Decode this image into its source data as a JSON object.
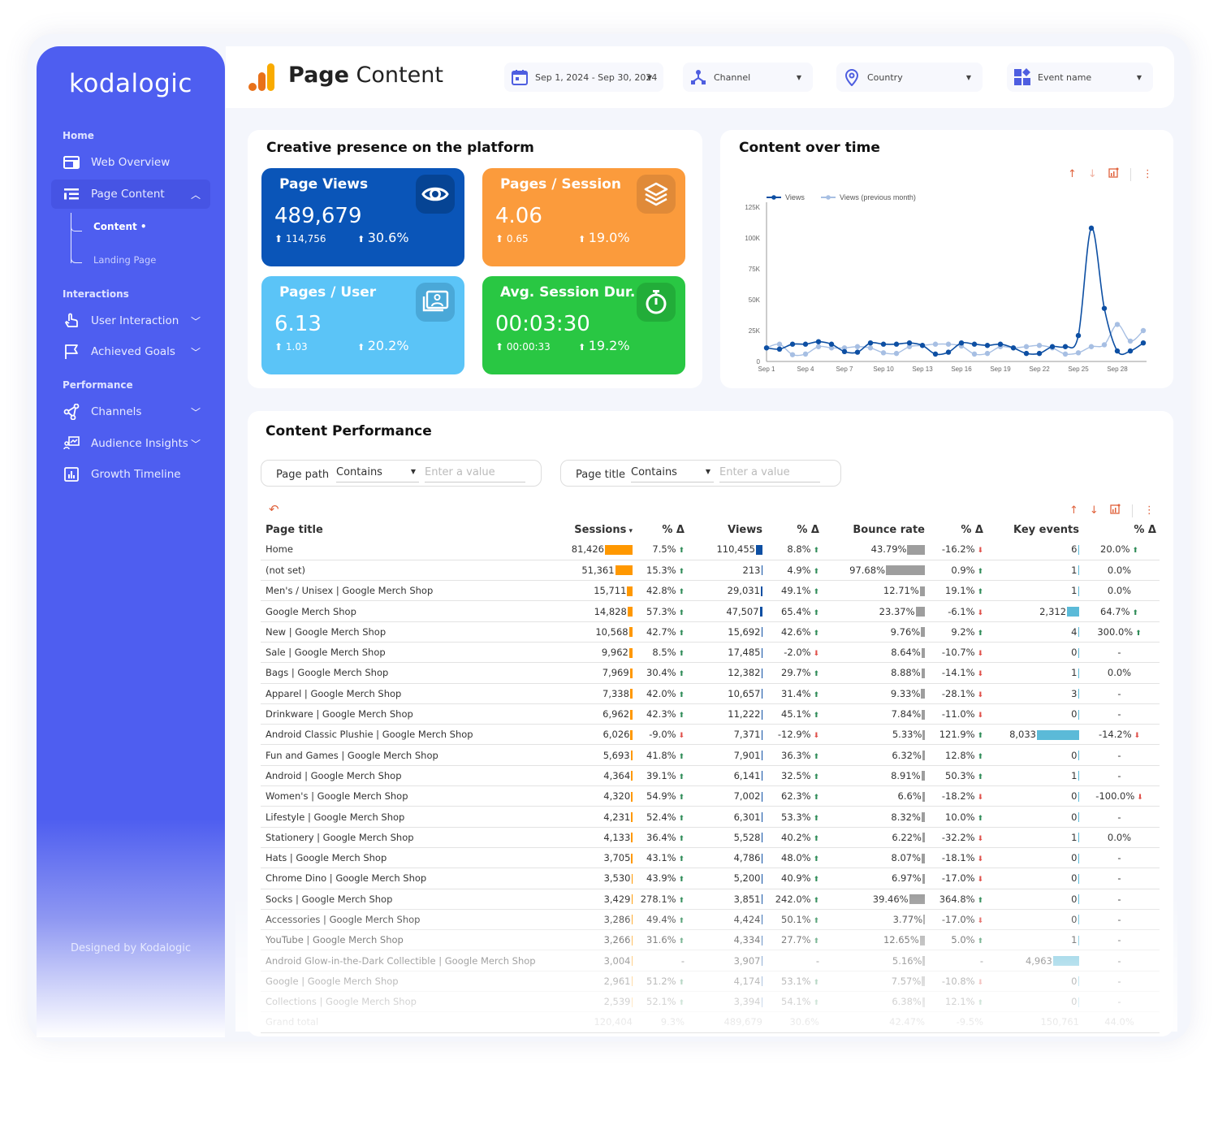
{
  "sidebar": {
    "logo": "kodalogic",
    "sections": [
      {
        "label": "Home"
      },
      {
        "label": "Interactions"
      },
      {
        "label": "Performance"
      }
    ],
    "items": [
      {
        "label": "Web Overview",
        "icon": "layout-icon"
      },
      {
        "label": "Page Content",
        "icon": "list-icon",
        "expanded": true
      },
      {
        "label": "User Interaction",
        "icon": "hand-pointer-icon"
      },
      {
        "label": "Achieved Goals",
        "icon": "flag-icon"
      },
      {
        "label": "Channels",
        "icon": "share-nodes-icon"
      },
      {
        "label": "Audience Insights",
        "icon": "presentation-icon"
      },
      {
        "label": "Growth Timeline",
        "icon": "bar-chart-icon"
      }
    ],
    "subitems": [
      {
        "label": "Content •",
        "active": true
      },
      {
        "label": "Landing Page",
        "active": false
      }
    ],
    "footer": "Designed by Kodalogic"
  },
  "header": {
    "title_bold": "Page",
    "title_rest": " Content",
    "filters": [
      {
        "label": "Sep 1, 2024 - Sep 30, 2024",
        "icon": "calendar-icon"
      },
      {
        "label": "Channel",
        "icon": "hierarchy-icon"
      },
      {
        "label": "Country",
        "icon": "location-pin-icon"
      },
      {
        "label": "Event name",
        "icon": "widgets-icon"
      }
    ]
  },
  "kpi_card": {
    "title": "Creative presence on the platform",
    "kpis": [
      {
        "title": "Page Views",
        "value": "489,679",
        "change_abs": "114,756",
        "change_pct": "30.6%",
        "color": "#0a55b8",
        "icon": "eye-icon"
      },
      {
        "title": "Pages / Session",
        "value": "4.06",
        "change_abs": "0.65",
        "change_pct": "19.0%",
        "color": "#fb9b3c",
        "icon": "layers-icon"
      },
      {
        "title": "Pages / User",
        "value": "6.13",
        "change_abs": "1.03",
        "change_pct": "20.2%",
        "color": "#5bc4f7",
        "icon": "user-portrait-icon"
      },
      {
        "title": "Avg. Session Dur.",
        "value": "00:03:30",
        "change_abs": "00:00:33",
        "change_pct": "19.2%",
        "color": "#29c743",
        "icon": "stopwatch-icon"
      }
    ]
  },
  "chart_data": {
    "type": "line",
    "title": "Content over time",
    "x": [
      "Sep 1",
      "Sep 2",
      "Sep 3",
      "Sep 4",
      "Sep 5",
      "Sep 6",
      "Sep 7",
      "Sep 8",
      "Sep 9",
      "Sep 10",
      "Sep 11",
      "Sep 12",
      "Sep 13",
      "Sep 14",
      "Sep 15",
      "Sep 16",
      "Sep 17",
      "Sep 18",
      "Sep 19",
      "Sep 20",
      "Sep 21",
      "Sep 22",
      "Sep 23",
      "Sep 24",
      "Sep 25",
      "Sep 26",
      "Sep 27",
      "Sep 28",
      "Sep 29",
      "Sep 30"
    ],
    "x_tick_labels": [
      "Sep 1",
      "Sep 4",
      "Sep 7",
      "Sep 10",
      "Sep 13",
      "Sep 16",
      "Sep 19",
      "Sep 22",
      "Sep 25",
      "Sep 28"
    ],
    "y_tick_labels": [
      "0",
      "25K",
      "50K",
      "75K",
      "100K",
      "125K"
    ],
    "ylim": [
      0,
      125000
    ],
    "legend": "top-left",
    "grid": false,
    "series": [
      {
        "name": "Views",
        "color": "#0d4fa3",
        "values": [
          11000,
          10000,
          14000,
          14000,
          16000,
          14000,
          8000,
          7500,
          15000,
          14000,
          14000,
          15000,
          13000,
          6000,
          7500,
          15000,
          14000,
          13000,
          14000,
          11000,
          6500,
          6500,
          12000,
          12000,
          21000,
          108000,
          43000,
          8500,
          8500,
          15000
        ]
      },
      {
        "name": "Views (previous month)",
        "color": "#a7bfe3",
        "values": [
          11000,
          14000,
          5500,
          6000,
          12000,
          11000,
          11000,
          12000,
          11000,
          7000,
          6500,
          12000,
          13000,
          14000,
          14000,
          12500,
          6000,
          6500,
          12000,
          11000,
          12000,
          13000,
          11000,
          6000,
          7000,
          12000,
          13500,
          30000,
          16500,
          25000
        ]
      }
    ]
  },
  "performance": {
    "title": "Content Performance",
    "filters": [
      {
        "label": "Page path",
        "operator": "Contains",
        "placeholder": "Enter a value"
      },
      {
        "label": "Page title",
        "operator": "Contains",
        "placeholder": "Enter a value"
      }
    ],
    "columns": [
      "Page title",
      "Sessions",
      "% Δ",
      "Views",
      "% Δ",
      "Bounce rate",
      "% Δ",
      "Key events",
      "% Δ"
    ],
    "colors": {
      "sessions": "#ff9800",
      "views": "#0d4fa3",
      "bounce": "#9e9e9e",
      "key_events": "#5bbad8"
    },
    "rows": [
      [
        "Home",
        "81,426",
        "7.5%",
        "110,455",
        "8.8%",
        "43.79%",
        "-16.2%",
        "6",
        "20.0%"
      ],
      [
        "(not set)",
        "51,361",
        "15.3%",
        "213",
        "4.9%",
        "97.68%",
        "0.9%",
        "1",
        "0.0%"
      ],
      [
        "Men's / Unisex | Google Merch Shop",
        "15,711",
        "42.8%",
        "29,031",
        "49.1%",
        "12.71%",
        "19.1%",
        "1",
        "0.0%"
      ],
      [
        "Google Merch Shop",
        "14,828",
        "57.3%",
        "47,507",
        "65.4%",
        "23.37%",
        "-6.1%",
        "2,312",
        "64.7%"
      ],
      [
        "New | Google Merch Shop",
        "10,568",
        "42.7%",
        "15,692",
        "42.6%",
        "9.76%",
        "9.2%",
        "4",
        "300.0%"
      ],
      [
        "Sale | Google Merch Shop",
        "9,962",
        "8.5%",
        "17,485",
        "-2.0%",
        "8.64%",
        "-10.7%",
        "0",
        "-"
      ],
      [
        "Bags | Google Merch Shop",
        "7,969",
        "30.4%",
        "12,382",
        "29.7%",
        "8.88%",
        "-14.1%",
        "1",
        "0.0%"
      ],
      [
        "Apparel | Google Merch Shop",
        "7,338",
        "42.0%",
        "10,657",
        "31.4%",
        "9.33%",
        "-28.1%",
        "3",
        "-"
      ],
      [
        "Drinkware | Google Merch Shop",
        "6,962",
        "42.3%",
        "11,222",
        "45.1%",
        "7.84%",
        "-11.0%",
        "0",
        "-"
      ],
      [
        "Android Classic Plushie | Google Merch Shop",
        "6,026",
        "-9.0%",
        "7,371",
        "-12.9%",
        "5.33%",
        "121.9%",
        "8,033",
        "-14.2%"
      ],
      [
        "Fun and Games | Google Merch Shop",
        "5,693",
        "41.8%",
        "7,901",
        "36.3%",
        "6.32%",
        "12.8%",
        "0",
        "-"
      ],
      [
        "Android | Google Merch Shop",
        "4,364",
        "39.1%",
        "6,141",
        "32.5%",
        "8.91%",
        "50.3%",
        "1",
        "-"
      ],
      [
        "Women's | Google Merch Shop",
        "4,320",
        "54.9%",
        "7,002",
        "62.3%",
        "6.6%",
        "-18.2%",
        "0",
        "-100.0%"
      ],
      [
        "Lifestyle | Google Merch Shop",
        "4,231",
        "52.4%",
        "6,301",
        "53.3%",
        "8.32%",
        "10.0%",
        "0",
        "-"
      ],
      [
        "Stationery | Google Merch Shop",
        "4,133",
        "36.4%",
        "5,528",
        "40.2%",
        "6.22%",
        "-32.2%",
        "1",
        "0.0%"
      ],
      [
        "Hats | Google Merch Shop",
        "3,705",
        "43.1%",
        "4,786",
        "48.0%",
        "8.07%",
        "-18.1%",
        "0",
        "-"
      ],
      [
        "Chrome Dino | Google Merch Shop",
        "3,530",
        "43.9%",
        "5,200",
        "40.9%",
        "6.97%",
        "-17.0%",
        "0",
        "-"
      ],
      [
        "Socks | Google Merch Shop",
        "3,429",
        "278.1%",
        "3,851",
        "242.0%",
        "39.46%",
        "364.8%",
        "0",
        "-"
      ],
      [
        "Accessories | Google Merch Shop",
        "3,286",
        "49.4%",
        "4,424",
        "50.1%",
        "3.77%",
        "-17.0%",
        "0",
        "-"
      ],
      [
        "YouTube | Google Merch Shop",
        "3,266",
        "31.6%",
        "4,334",
        "27.7%",
        "12.65%",
        "5.0%",
        "1",
        "-"
      ],
      [
        "Android Glow-in-the-Dark Collectible | Google Merch Shop",
        "3,004",
        "-",
        "3,907",
        "-",
        "5.16%",
        "-",
        "4,963",
        "-"
      ],
      [
        "Google | Google Merch Shop",
        "2,961",
        "51.2%",
        "4,174",
        "53.1%",
        "7.57%",
        "-10.8%",
        "0",
        "-"
      ],
      [
        "Collections | Google Merch Shop",
        "2,539",
        "52.1%",
        "3,394",
        "54.1%",
        "6.38%",
        "12.1%",
        "0",
        "-"
      ]
    ],
    "grand_total": [
      "Grand total",
      "120,404",
      "9.3%",
      "489,679",
      "30.6%",
      "42.47%",
      "-9.5%",
      "150,761",
      "44.0%"
    ]
  }
}
